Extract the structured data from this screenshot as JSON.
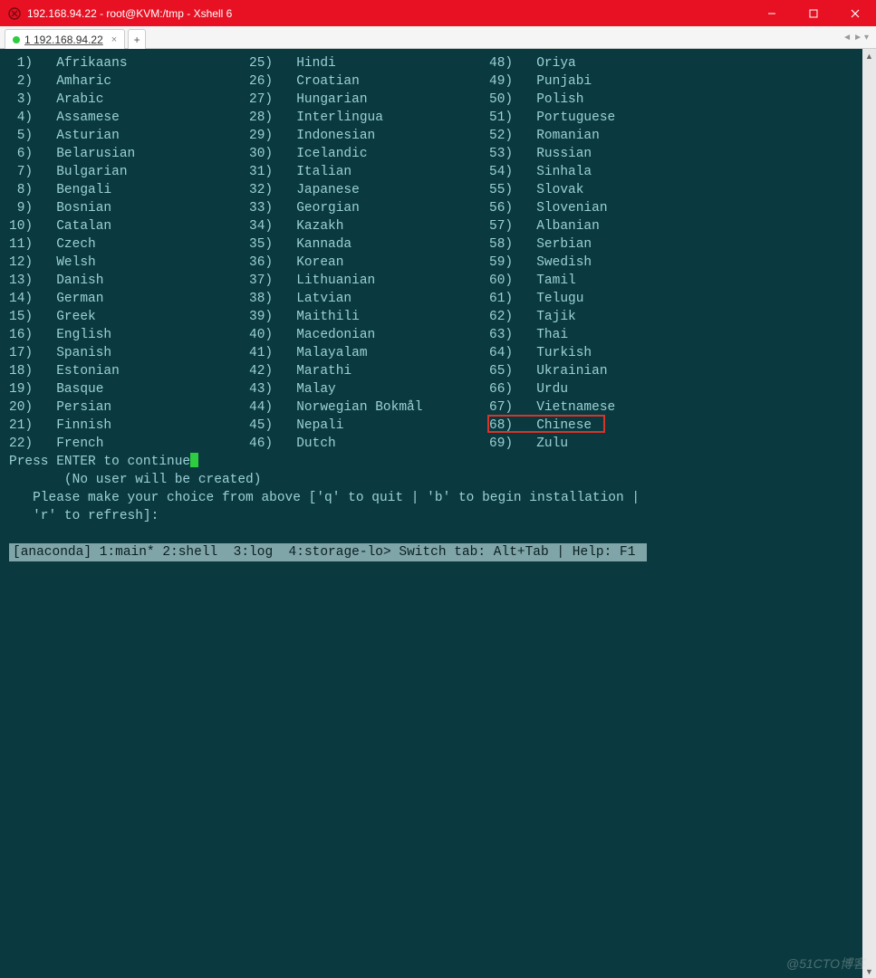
{
  "window": {
    "title": "192.168.94.22 - root@KVM:/tmp - Xshell 6"
  },
  "tab": {
    "label": "1 192.168.94.22"
  },
  "languages_col1": [
    {
      "n": "1",
      "name": "Afrikaans"
    },
    {
      "n": "2",
      "name": "Amharic"
    },
    {
      "n": "3",
      "name": "Arabic"
    },
    {
      "n": "4",
      "name": "Assamese"
    },
    {
      "n": "5",
      "name": "Asturian"
    },
    {
      "n": "6",
      "name": "Belarusian"
    },
    {
      "n": "7",
      "name": "Bulgarian"
    },
    {
      "n": "8",
      "name": "Bengali"
    },
    {
      "n": "9",
      "name": "Bosnian"
    },
    {
      "n": "10",
      "name": "Catalan"
    },
    {
      "n": "11",
      "name": "Czech"
    },
    {
      "n": "12",
      "name": "Welsh"
    },
    {
      "n": "13",
      "name": "Danish"
    },
    {
      "n": "14",
      "name": "German"
    },
    {
      "n": "15",
      "name": "Greek"
    },
    {
      "n": "16",
      "name": "English"
    },
    {
      "n": "17",
      "name": "Spanish"
    },
    {
      "n": "18",
      "name": "Estonian"
    },
    {
      "n": "19",
      "name": "Basque"
    },
    {
      "n": "20",
      "name": "Persian"
    },
    {
      "n": "21",
      "name": "Finnish"
    },
    {
      "n": "22",
      "name": "French"
    }
  ],
  "languages_col2": [
    {
      "n": "25",
      "name": "Hindi"
    },
    {
      "n": "26",
      "name": "Croatian"
    },
    {
      "n": "27",
      "name": "Hungarian"
    },
    {
      "n": "28",
      "name": "Interlingua"
    },
    {
      "n": "29",
      "name": "Indonesian"
    },
    {
      "n": "30",
      "name": "Icelandic"
    },
    {
      "n": "31",
      "name": "Italian"
    },
    {
      "n": "32",
      "name": "Japanese"
    },
    {
      "n": "33",
      "name": "Georgian"
    },
    {
      "n": "34",
      "name": "Kazakh"
    },
    {
      "n": "35",
      "name": "Kannada"
    },
    {
      "n": "36",
      "name": "Korean"
    },
    {
      "n": "37",
      "name": "Lithuanian"
    },
    {
      "n": "38",
      "name": "Latvian"
    },
    {
      "n": "39",
      "name": "Maithili"
    },
    {
      "n": "40",
      "name": "Macedonian"
    },
    {
      "n": "41",
      "name": "Malayalam"
    },
    {
      "n": "42",
      "name": "Marathi"
    },
    {
      "n": "43",
      "name": "Malay"
    },
    {
      "n": "44",
      "name": "Norwegian Bokmål"
    },
    {
      "n": "45",
      "name": "Nepali"
    },
    {
      "n": "46",
      "name": "Dutch"
    }
  ],
  "languages_col3": [
    {
      "n": "48",
      "name": "Oriya"
    },
    {
      "n": "49",
      "name": "Punjabi"
    },
    {
      "n": "50",
      "name": "Polish"
    },
    {
      "n": "51",
      "name": "Portuguese"
    },
    {
      "n": "52",
      "name": "Romanian"
    },
    {
      "n": "53",
      "name": "Russian"
    },
    {
      "n": "54",
      "name": "Sinhala"
    },
    {
      "n": "55",
      "name": "Slovak"
    },
    {
      "n": "56",
      "name": "Slovenian"
    },
    {
      "n": "57",
      "name": "Albanian"
    },
    {
      "n": "58",
      "name": "Serbian"
    },
    {
      "n": "59",
      "name": "Swedish"
    },
    {
      "n": "60",
      "name": "Tamil"
    },
    {
      "n": "61",
      "name": "Telugu"
    },
    {
      "n": "62",
      "name": "Tajik"
    },
    {
      "n": "63",
      "name": "Thai"
    },
    {
      "n": "64",
      "name": "Turkish"
    },
    {
      "n": "65",
      "name": "Ukrainian"
    },
    {
      "n": "66",
      "name": "Urdu"
    },
    {
      "n": "67",
      "name": "Vietnamese"
    },
    {
      "n": "68",
      "name": "Chinese"
    },
    {
      "n": "69",
      "name": "Zulu"
    }
  ],
  "highlighted": {
    "n": "68",
    "name": "Chinese"
  },
  "prompt": {
    "continue": "Press ENTER to continue",
    "no_user": "(No user will be created)",
    "choice": "Please make your choice from above ['q' to quit | 'b' to begin installation |",
    "choice2": "'r' to refresh]:"
  },
  "status": "[anaconda] 1:main* 2:shell  3:log  4:storage-lo> Switch tab: Alt+Tab | Help: F1 ",
  "watermark": "@51CTO博客"
}
